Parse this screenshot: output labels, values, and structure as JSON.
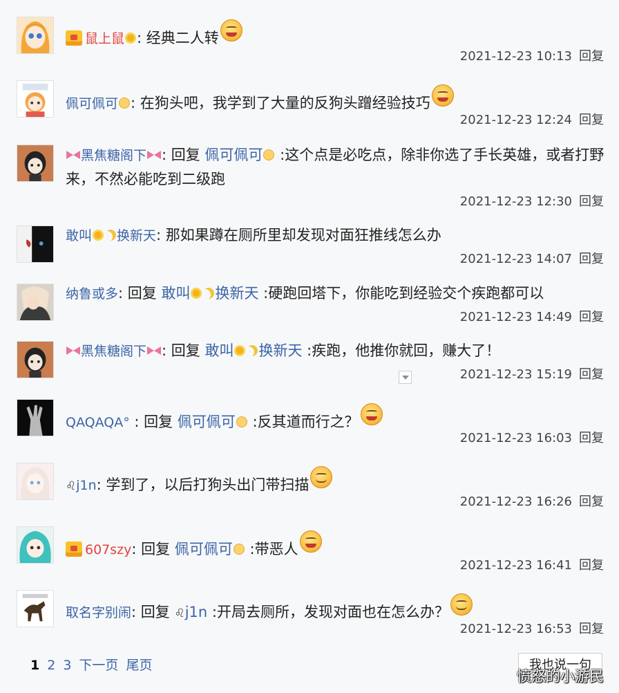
{
  "comments": [
    {
      "user": "鼠上鼠",
      "user_suffix_icon": "sunflower-icon",
      "vip": true,
      "reply_word": "",
      "reply_target": "",
      "content": ": 经典二人转",
      "timestamp": "2021-12-23 10:13",
      "reply_label": "回复",
      "avatar": "anime-girl-orange-hair"
    },
    {
      "user": "佩可佩可",
      "user_suffix_icon": "smile-emoji-icon",
      "vip": false,
      "reply_word": "",
      "reply_target": "",
      "content": ": 在狗头吧，我学到了大量的反狗头蹭经验技巧",
      "timestamp": "2021-12-23 12:24",
      "reply_label": "回复",
      "avatar": "anime-chibi-girl"
    },
    {
      "user": "黑焦糖阁下",
      "user_suffix_icon": "bow-icon",
      "vip": false,
      "reply_word": ": 回复 ",
      "reply_target": "佩可佩可",
      "content": " :这个点是必吃点，除非你选了手长英雄，或者打野来，不然必能吃到二级跑",
      "timestamp": "2021-12-23 12:30",
      "reply_label": "回复",
      "avatar": "cartoon-head"
    },
    {
      "user": "敢叫",
      "user_suffix": "换新天",
      "vip": false,
      "reply_word": "",
      "reply_target": "",
      "content": ": 那如果蹲在厕所里却发现对面狂推线怎么办",
      "timestamp": "2021-12-23 14:07",
      "reply_label": "回复",
      "avatar": "dark-wolf"
    },
    {
      "user": "纳鲁或多",
      "vip": false,
      "reply_word": ": 回复 ",
      "reply_target": "敢叫",
      "reply_target_suffix": "换新天",
      "content": " :硬跑回塔下，你能吃到经验交个疾跑都可以",
      "timestamp": "2021-12-23 14:49",
      "reply_label": "回复",
      "avatar": "anime-character"
    },
    {
      "user": "黑焦糖阁下",
      "vip": false,
      "reply_word": ": 回复 ",
      "reply_target": "敢叫",
      "reply_target_suffix": "换新天",
      "content": " :疾跑，他推你就回，赚大了！",
      "timestamp": "2021-12-23 15:19",
      "reply_label": "回复",
      "avatar": "cartoon-head"
    },
    {
      "user": "QAQAQA°",
      "vip": false,
      "reply_word": " : 回复 ",
      "reply_target": "佩可佩可",
      "content": " :反其道而行之？",
      "timestamp": "2021-12-23 16:03",
      "reply_label": "回复",
      "avatar": "xray-hand"
    },
    {
      "user": "j1n",
      "user_prefix": "♌",
      "vip": false,
      "reply_word": "",
      "reply_target": "",
      "content": ": 学到了，以后打狗头出门带扫描",
      "timestamp": "2021-12-23 16:26",
      "reply_label": "回复",
      "avatar": "anime-girl-white-hair"
    },
    {
      "user": "607szy",
      "vip": true,
      "reply_word": ": 回复 ",
      "reply_target": "佩可佩可",
      "content": " :带恶人",
      "timestamp": "2021-12-23 16:41",
      "reply_label": "回复",
      "avatar": "anime-girl-teal-hair"
    },
    {
      "user": "取名字别闹",
      "vip": false,
      "reply_word": ": 回复 ",
      "reply_target": "j1n",
      "reply_target_prefix": "♌",
      "content": " :开局去厕所，发现对面也在怎么办？",
      "timestamp": "2021-12-23 16:53",
      "reply_label": "回复",
      "avatar": "cartoon-horse"
    }
  ],
  "pager": {
    "current": "1",
    "pages": [
      "2",
      "3"
    ],
    "next": "下一页",
    "last": "尾页"
  },
  "say_button": "我也说一句",
  "watermark": "愤怒的小游民",
  "colors": {
    "username": "#3c65a6",
    "vip_username": "#e4423e",
    "text": "#222222",
    "background": "#f7f8fa"
  }
}
